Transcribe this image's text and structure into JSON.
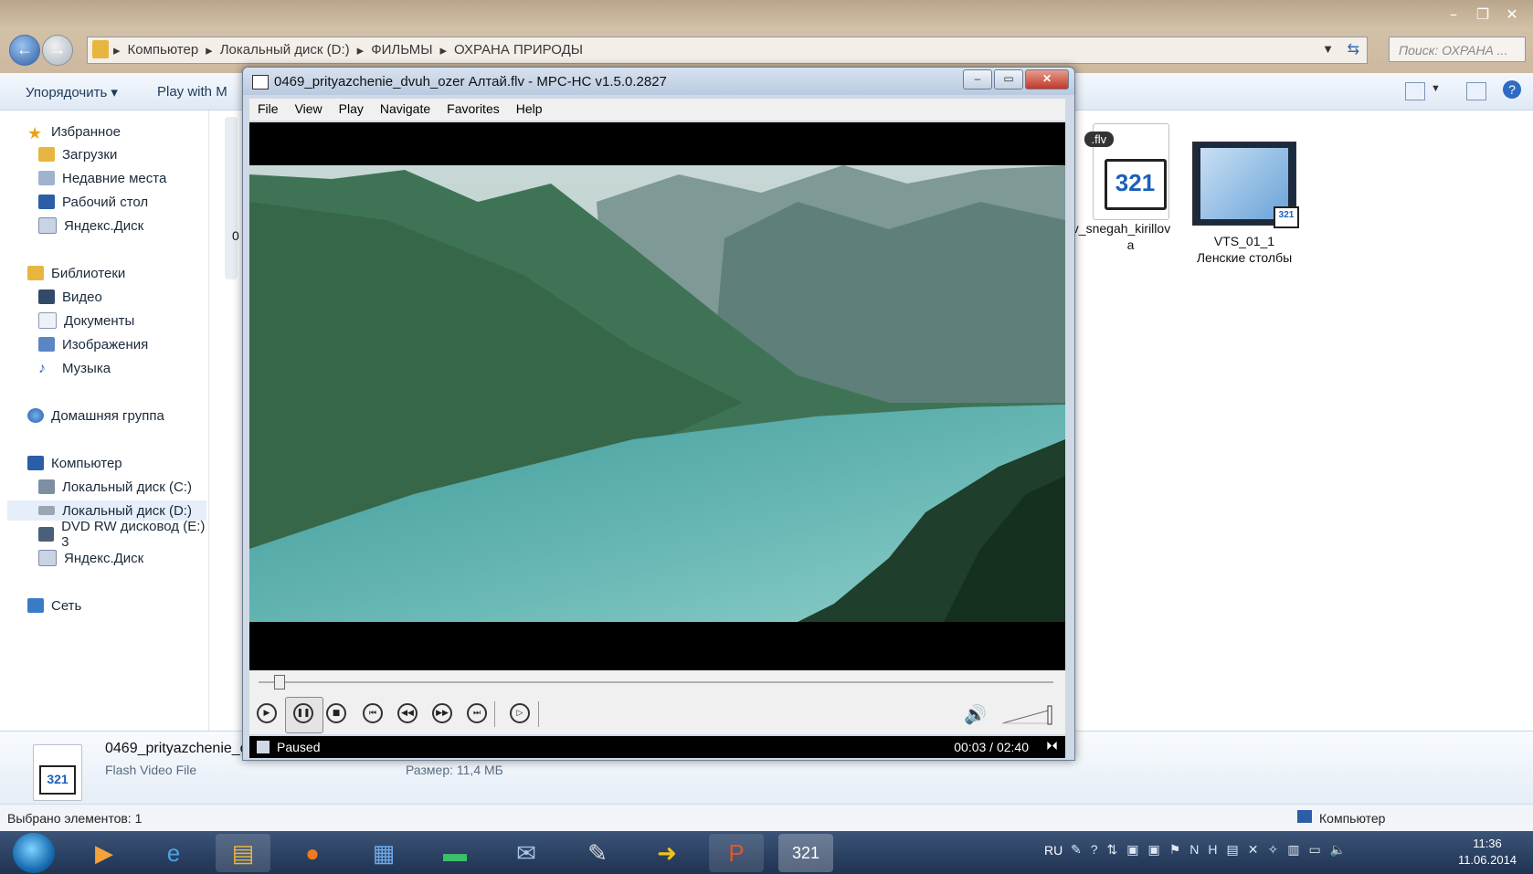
{
  "explorer": {
    "breadcrumbs": [
      "Компьютер",
      "Локальный диск (D:)",
      "ФИЛЬМЫ",
      "ОХРАНА ПРИРОДЫ"
    ],
    "search_placeholder": "Поиск: ОХРАНА ...",
    "toolbar": {
      "organize": "Упорядочить",
      "play_with": "Play with M"
    },
    "sidebar": {
      "favorites": "Избранное",
      "fav_items": [
        "Загрузки",
        "Недавние места",
        "Рабочий стол",
        "Яндекс.Диск"
      ],
      "libraries": "Библиотеки",
      "lib_items": [
        "Видео",
        "Документы",
        "Изображения",
        "Музыка"
      ],
      "homegroup": "Домашняя группа",
      "computer": "Компьютер",
      "comp_items": [
        "Локальный диск (C:)",
        "Локальный диск (D:)",
        "DVD RW дисковод (E:) 3",
        "Яндекс.Диск"
      ],
      "network": "Сеть"
    },
    "files": [
      {
        "name": "v_snegah_kirillov",
        "name2": "a",
        "badge": ".flv"
      },
      {
        "name": "VTS_01_1",
        "name2": "Ленские столбы"
      }
    ],
    "partial_label": "0",
    "details": {
      "filename": "0469_prityazchenie_c",
      "type": "Flash Video File",
      "size": "Размер: 11,4 МБ"
    },
    "status": {
      "selected": "Выбрано элементов: 1",
      "location": "Компьютер"
    }
  },
  "mpc": {
    "title": "0469_prityazchenie_dvuh_ozer Алтай.flv - MPC-HC v1.5.0.2827",
    "menu": [
      "File",
      "View",
      "Play",
      "Navigate",
      "Favorites",
      "Help"
    ],
    "state": "Paused",
    "time": "00:03 / 02:40",
    "progress": 0.019
  },
  "taskbar": {
    "lang": "RU",
    "time": "11:36",
    "date": "11.06.2014"
  }
}
